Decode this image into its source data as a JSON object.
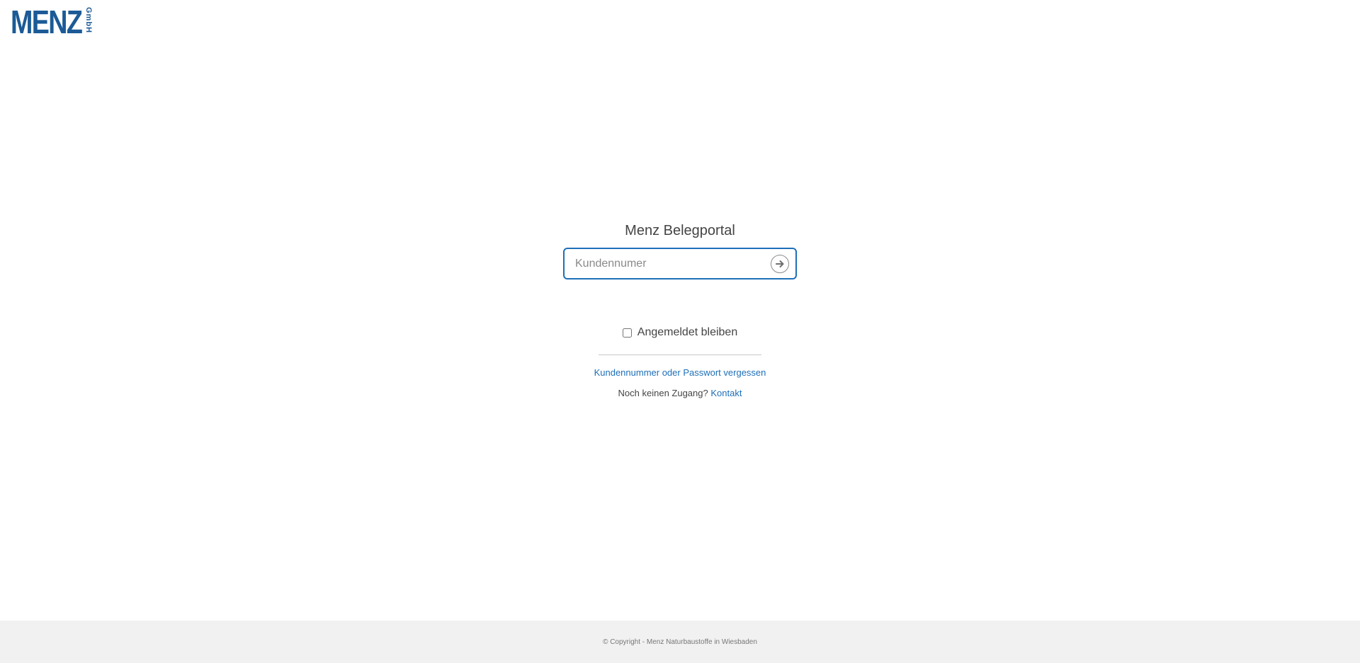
{
  "brand": {
    "logo_main": "MENZ",
    "logo_sub": "GmbH",
    "color": "#1b5a96"
  },
  "login": {
    "title": "Menz Belegportal",
    "customer_placeholder": "Kundennumer",
    "customer_value": "",
    "submit_icon": "arrow-right-circle-icon",
    "remember_label": "Angemeldet bleiben",
    "remember_checked": false,
    "forgot_link": "Kundennummer oder Passwort vergessen",
    "no_access_text": "Noch keinen Zugang?",
    "contact_link": "Kontakt",
    "accent_color": "#1e6fb8"
  },
  "footer": {
    "copyright": "© Copyright - Menz Naturbaustoffe in Wiesbaden"
  }
}
